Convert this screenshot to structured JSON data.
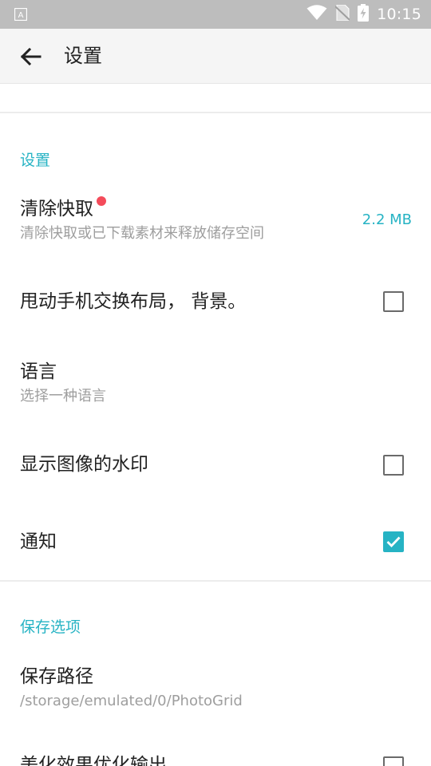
{
  "status_bar": {
    "time": "10:15",
    "icons": [
      "notification-a-icon",
      "wifi-icon",
      "no-sim-icon",
      "battery-charging-icon"
    ]
  },
  "app_bar": {
    "title": "设置",
    "back_icon": "arrow-left-icon"
  },
  "sections": [
    {
      "header": "设置",
      "items": [
        {
          "title": "清除快取",
          "subtitle": "清除快取或已下载素材来释放储存空间",
          "value": "2.2 MB",
          "badge": "red-dot"
        },
        {
          "title": "甩动手机交换布局， 背景。",
          "checkbox": false
        },
        {
          "title": "语言",
          "subtitle": "选择一种语言"
        },
        {
          "title": "显示图像的水印",
          "checkbox": false
        },
        {
          "title": "通知",
          "checkbox": true
        }
      ]
    },
    {
      "header": "保存选项",
      "items": [
        {
          "title": "保存路径",
          "subtitle": "/storage/emulated/0/PhotoGrid"
        },
        {
          "title": "美化效果优化输出",
          "checkbox": false
        }
      ]
    }
  ],
  "colors": {
    "accent": "#26b3c4",
    "status_bar": "#bdbdbd",
    "app_bar": "#f5f5f5",
    "red_dot": "#f44b5a"
  }
}
